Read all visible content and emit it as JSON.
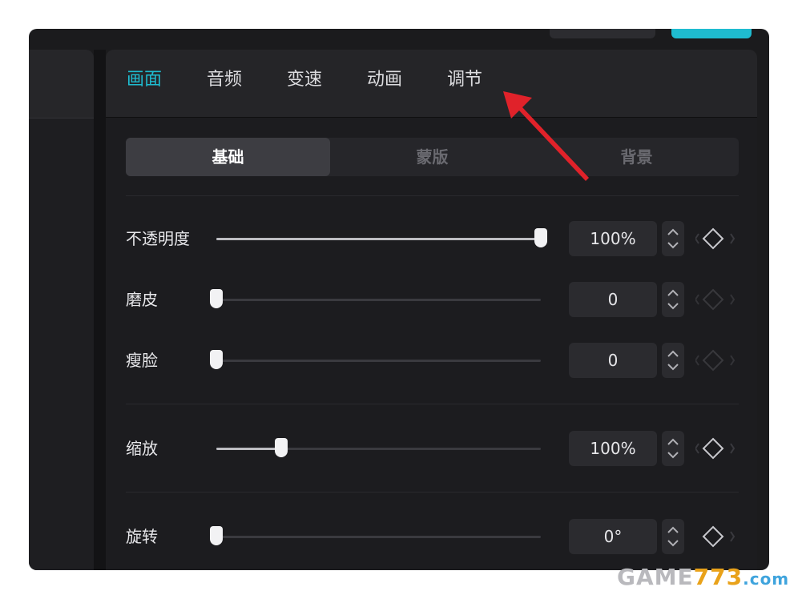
{
  "tabs": [
    {
      "label": "画面"
    },
    {
      "label": "音频"
    },
    {
      "label": "变速"
    },
    {
      "label": "动画"
    },
    {
      "label": "调节"
    }
  ],
  "segments": [
    {
      "label": "基础"
    },
    {
      "label": "蒙版"
    },
    {
      "label": "背景"
    }
  ],
  "rows": {
    "opacity": {
      "label": "不透明度",
      "value": "100%",
      "level": 1.0
    },
    "smooth": {
      "label": "磨皮",
      "value": "0",
      "level": 0.0
    },
    "slim": {
      "label": "瘦脸",
      "value": "0",
      "level": 0.0
    },
    "scale": {
      "label": "缩放",
      "value": "100%",
      "level": 0.2
    },
    "rotate": {
      "label": "旋转",
      "value": "0°",
      "level": 0.0
    }
  },
  "colors": {
    "accent": "#1fbcd0",
    "arrow": "#e0222a"
  },
  "icons": [
    "stepper-icon",
    "keyframe-diamond-icon",
    "chevron-left-icon",
    "chevron-right-icon"
  ],
  "watermark": {
    "part1": "GAME",
    "part2": "773",
    "part3": ".com"
  }
}
